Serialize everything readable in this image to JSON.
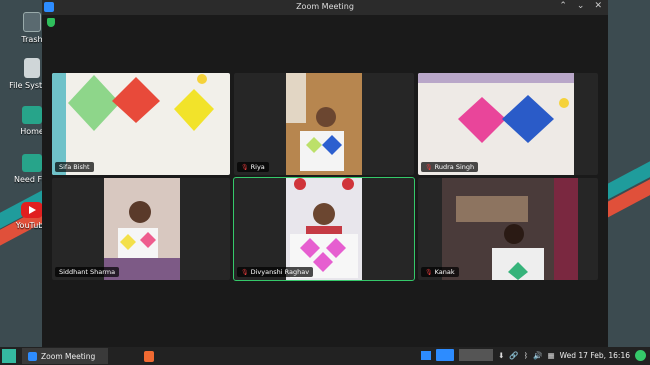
{
  "window": {
    "title": "Zoom Meeting",
    "controls": [
      "⌃",
      "⌄",
      "✕"
    ]
  },
  "desktop": {
    "icons": [
      {
        "label": "Trash",
        "icon": "trash-icon"
      },
      {
        "label": "File System",
        "icon": "drive-icon"
      },
      {
        "label": "Home",
        "icon": "folder-home-icon"
      },
      {
        "label": "Need For",
        "icon": "folder-icon"
      },
      {
        "label": "YouTube",
        "icon": "youtube-icon"
      }
    ]
  },
  "participants": [
    {
      "name": "Sifa Bisht",
      "muted": false
    },
    {
      "name": "Riya",
      "muted": true
    },
    {
      "name": "Rudra Singh",
      "muted": true
    },
    {
      "name": "Siddhant Sharma",
      "muted": false
    },
    {
      "name": "Divyanshi Raghav",
      "muted": true,
      "active": true
    },
    {
      "name": "Kanak",
      "muted": true
    }
  ],
  "taskbar": {
    "app_label": "Zoom Meeting",
    "clock": "Wed 17 Feb, 16:16"
  },
  "colors": {
    "active_speaker": "#35c96a",
    "muted_mic": "#e23b3b",
    "zoom_blue": "#2d8cff"
  }
}
